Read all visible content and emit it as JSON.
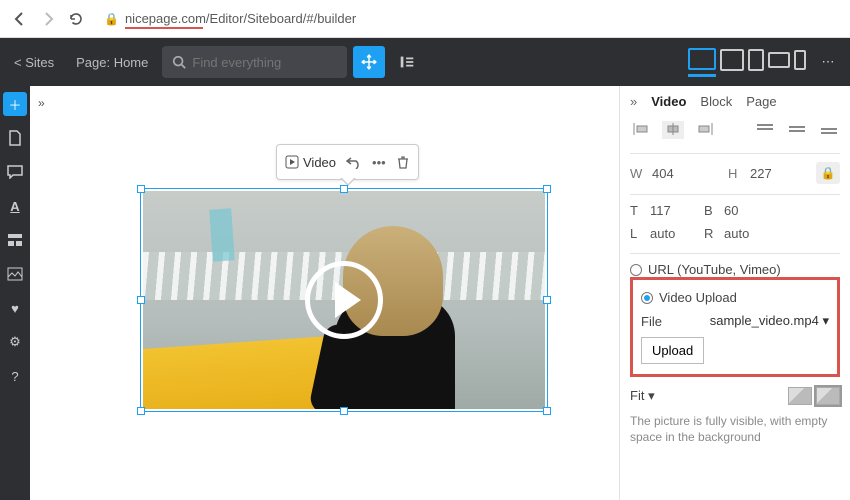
{
  "browser": {
    "url_host": "nicepage.com",
    "url_path": "/Editor/Siteboard/#/builder"
  },
  "appbar": {
    "back_label": "< Sites",
    "page_label": "Page: Home",
    "search_placeholder": "Find everything"
  },
  "toolbar": {
    "video_label": "Video"
  },
  "panel": {
    "tabs": {
      "video": "Video",
      "block": "Block",
      "page": "Page"
    },
    "dims": {
      "w_label": "W",
      "w": "404",
      "h_label": "H",
      "h": "227"
    },
    "pos": {
      "t_label": "T",
      "t": "117",
      "b_label": "B",
      "b": "60",
      "l_label": "L",
      "l": "auto",
      "r_label": "R",
      "r": "auto"
    },
    "source": {
      "url_label": "URL (YouTube, Vimeo)",
      "upload_label": "Video Upload",
      "file_label": "File",
      "file_name": "sample_video.mp4",
      "upload_btn": "Upload"
    },
    "fit": {
      "label": "Fit",
      "desc": "The picture is fully visible, with empty space in the background"
    }
  }
}
